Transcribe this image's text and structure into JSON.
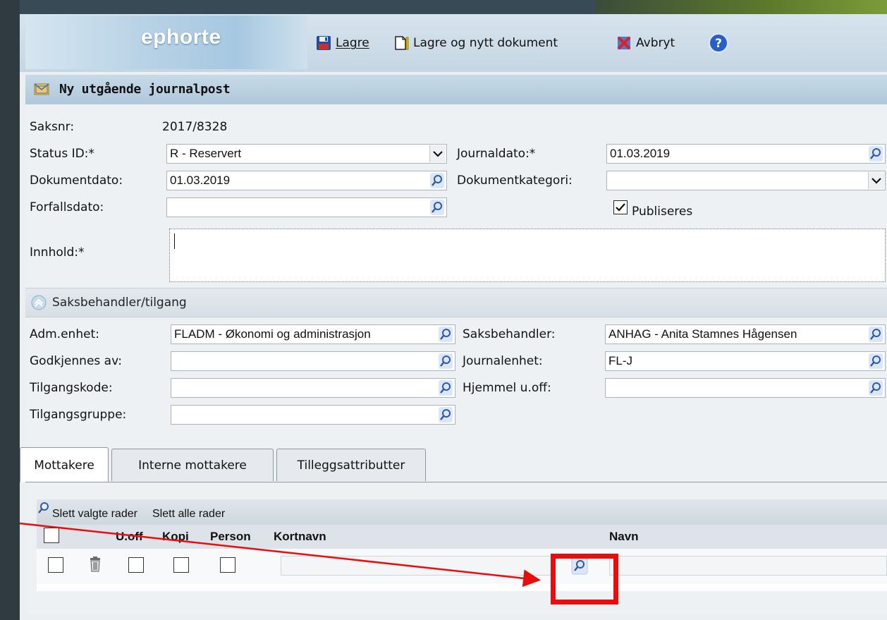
{
  "app": {
    "logo": "ephorte",
    "toolbar": {
      "save_label": "Lagre",
      "save_new_label": "Lagre og nytt dokument",
      "cancel_label": "Avbryt",
      "help_icon": "help-icon"
    },
    "title": "Ny utgående journalpost"
  },
  "form": {
    "saksnr_label": "Saksnr:",
    "saksnr_value": "2017/8328",
    "status_label": "Status ID:*",
    "status_value": "R - Reservert",
    "journaldato_label": "Journaldato:*",
    "journaldato_value": "01.03.2019",
    "dokumentdato_label": "Dokumentdato:",
    "dokumentdato_value": "01.03.2019",
    "dokumentkategori_label": "Dokumentkategori:",
    "dokumentkategori_value": "",
    "forfallsdato_label": "Forfallsdato:",
    "forfallsdato_value": "",
    "publiseres_label": "Publiseres",
    "publiseres_checked": true,
    "innhold_label": "Innhold:*",
    "innhold_value": ""
  },
  "section": {
    "title": "Saksbehandler/tilgang",
    "adm_label": "Adm.enhet:",
    "adm_value": "FLADM - Økonomi og administrasjon",
    "saksbehandler_label": "Saksbehandler:",
    "saksbehandler_value": "ANHAG - Anita Stamnes Hågensen",
    "godkjennes_label": "Godkjennes av:",
    "godkjennes_value": "",
    "journalenhet_label": "Journalenhet:",
    "journalenhet_value": "FL-J",
    "tilgangskode_label": "Tilgangskode:",
    "tilgangskode_value": "",
    "hjemmel_label": "Hjemmel u.off:",
    "hjemmel_value": "",
    "tilgangsgruppe_label": "Tilgangsgruppe:",
    "tilgangsgruppe_value": ""
  },
  "tabs": [
    {
      "label": "Mottakere",
      "active": true
    },
    {
      "label": "Interne mottakere",
      "active": false
    },
    {
      "label": "Tilleggsattributter",
      "active": false
    }
  ],
  "recipients": {
    "delete_selected": "Slett valgte rader",
    "delete_all": "Slett alle rader",
    "columns": [
      "U.off",
      "Kopi",
      "Person",
      "Kortnavn",
      "Navn"
    ]
  },
  "colors": {
    "annotation": "#ea0d0d"
  }
}
